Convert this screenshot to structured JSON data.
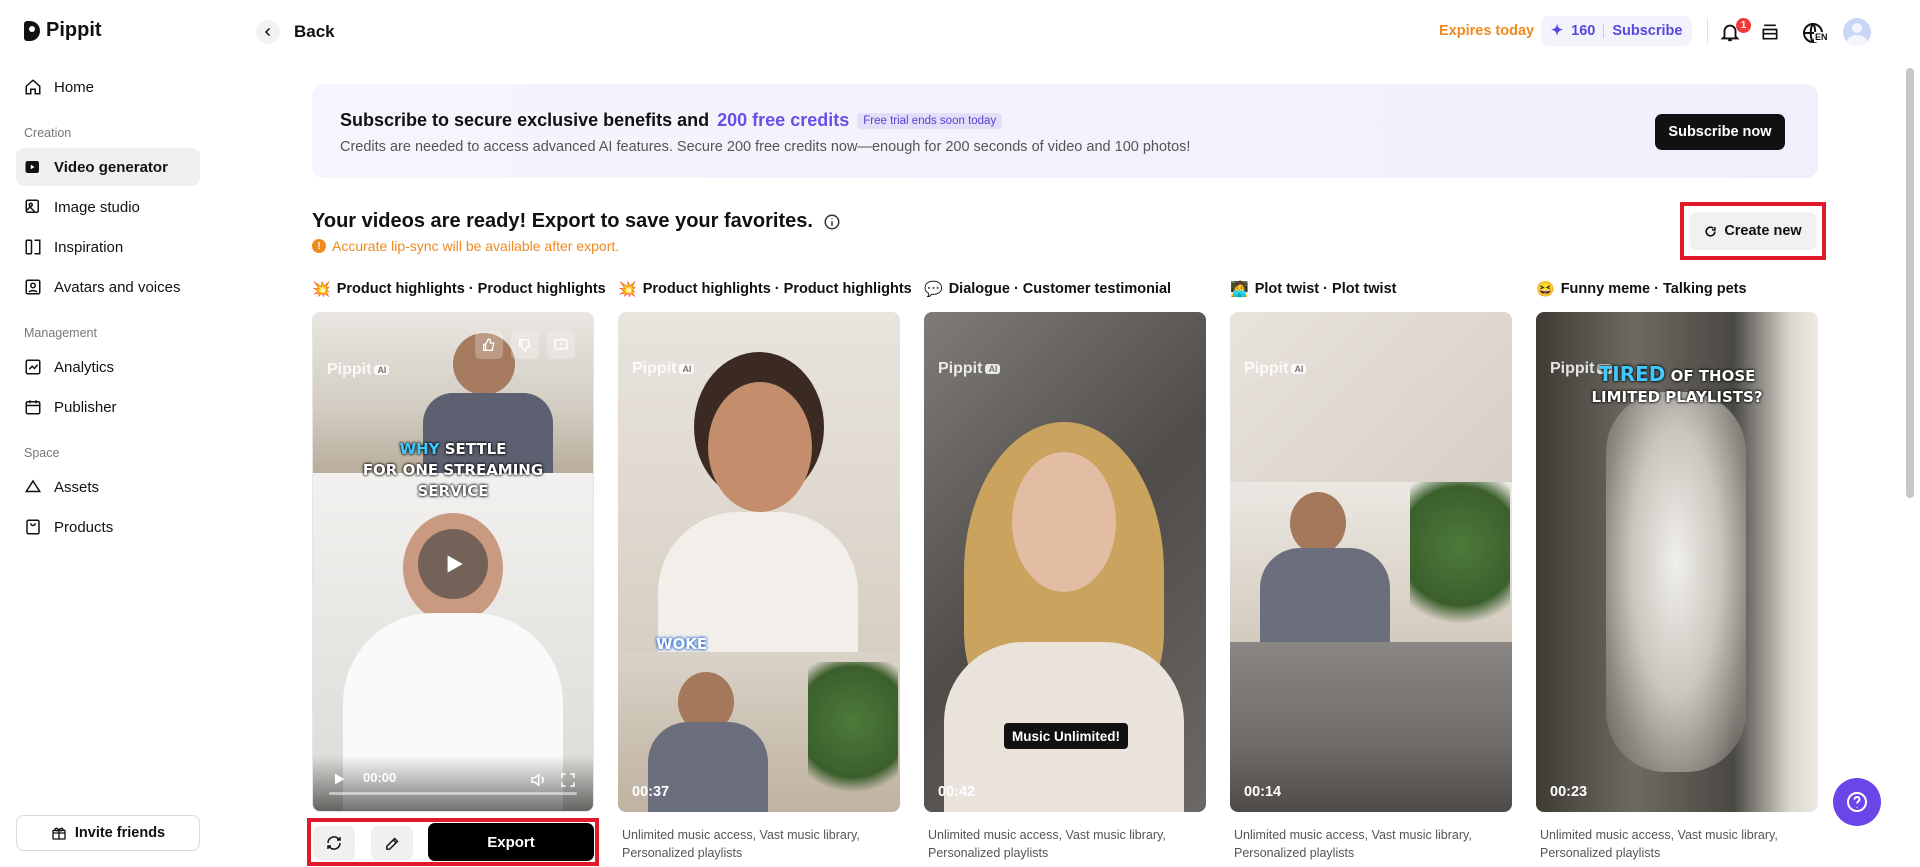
{
  "app": {
    "name": "Pippit"
  },
  "sidebar": {
    "home": "Home",
    "creation_label": "Creation",
    "video_generator": "Video generator",
    "image_studio": "Image studio",
    "inspiration": "Inspiration",
    "avatars": "Avatars and voices",
    "management_label": "Management",
    "analytics": "Analytics",
    "publisher": "Publisher",
    "space_label": "Space",
    "assets": "Assets",
    "products": "Products",
    "invite": "Invite friends"
  },
  "topbar": {
    "back": "Back",
    "expires": "Expires today",
    "credits": "160",
    "subscribe": "Subscribe",
    "notifications": "1",
    "lang": "EN"
  },
  "banner": {
    "title_prefix": "Subscribe to secure exclusive benefits and",
    "title_highlight": "200 free credits",
    "tag": "Free trial ends soon today",
    "subtitle": "Credits are needed to access advanced AI features. Secure 200 free credits now—enough for 200 seconds of video and 100 photos!",
    "button": "Subscribe now"
  },
  "main": {
    "heading": "Your videos are ready! Export to save your favorites.",
    "warning": "Accurate lip-sync will be available after export.",
    "create_new": "Create new",
    "export": "Export"
  },
  "watermark": {
    "brand": "Pippit",
    "ai": "AI"
  },
  "videos": [
    {
      "emoji": "💥",
      "title": "Product highlights · Product highlights",
      "duration": "00:00",
      "caption_hl": "WHY",
      "caption_rest": " SETTLE",
      "caption_line2": "FOR ONE STREAMING",
      "caption_line3": "SERVICE",
      "desc": ""
    },
    {
      "emoji": "💥",
      "title": "Product highlights · Product highlights",
      "duration": "00:37",
      "caption": "WOKE",
      "desc": "Unlimited music access, Vast music library, Personalized playlists"
    },
    {
      "emoji": "💬",
      "title": "Dialogue · Customer testimonial",
      "duration": "00:42",
      "caption": "Music Unlimited!",
      "desc": "Unlimited music access, Vast music library, Personalized playlists"
    },
    {
      "emoji": "🧑‍💻",
      "title": "Plot twist · Plot twist",
      "duration": "00:14",
      "desc": "Unlimited music access, Vast music library, Personalized playlists"
    },
    {
      "emoji": "😆",
      "title": "Funny meme · Talking pets",
      "duration": "00:23",
      "caption_hl": "TIRED",
      "caption_rest": " OF THOSE",
      "caption_line2": "LIMITED PLAYLISTS?",
      "desc": "Unlimited music access, Vast music library, Personalized playlists"
    }
  ]
}
